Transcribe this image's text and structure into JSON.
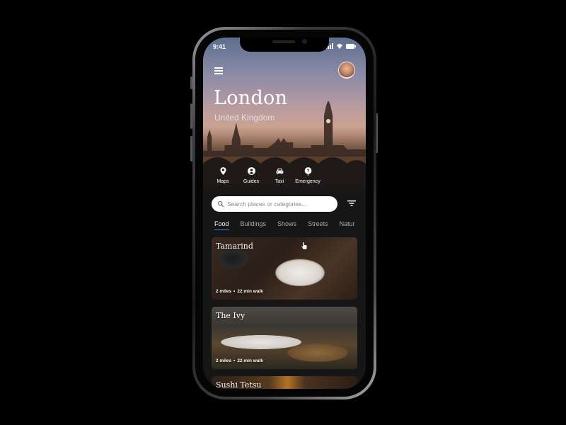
{
  "status_bar": {
    "time": "9:41"
  },
  "header": {
    "city": "London",
    "country": "United Kingdom"
  },
  "quick_actions": [
    {
      "label": "Maps",
      "icon": "map-pin-icon"
    },
    {
      "label": "Guides",
      "icon": "guide-person-icon"
    },
    {
      "label": "Taxi",
      "icon": "taxi-icon"
    },
    {
      "label": "Emergency",
      "icon": "emergency-help-icon"
    }
  ],
  "search": {
    "placeholder": "Search places or categories...",
    "value": ""
  },
  "tabs": [
    {
      "label": "Food",
      "active": true
    },
    {
      "label": "Buildings",
      "active": false
    },
    {
      "label": "Shows",
      "active": false
    },
    {
      "label": "Streets",
      "active": false
    },
    {
      "label": "Natur",
      "active": false
    }
  ],
  "places": [
    {
      "name": "Tamarind",
      "distance": "2 miles",
      "walk": "22 min walk"
    },
    {
      "name": "The Ivy",
      "distance": "2 miles",
      "walk": "22 min walk"
    },
    {
      "name": "Sushi Tetsu",
      "distance": "",
      "walk": ""
    }
  ],
  "colors": {
    "accent": "#3f7fe8",
    "background": "#161616"
  }
}
